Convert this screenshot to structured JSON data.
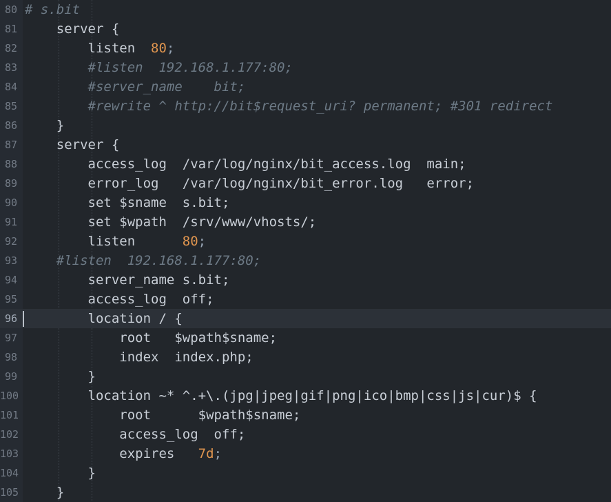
{
  "editor": {
    "app": "code-editor",
    "language": "nginx-conf",
    "first_line_number": 80,
    "current_line_number": 96,
    "colors": {
      "background": "#22262b",
      "gutter_background": "#262b32",
      "current_line_background": "#2c3138",
      "text": "#c8ced6",
      "line_number": "#737b86",
      "line_number_active": "#a3acb8",
      "comment": "#6d7a86",
      "number": "#e0954f",
      "punctuation": "#96a3b3",
      "caret": "#b9c0c8",
      "indent_guide": "#3d434b"
    },
    "lines": [
      {
        "n": "80",
        "current": false,
        "tokens": [
          {
            "t": "comment",
            "s": "# s.bit"
          }
        ]
      },
      {
        "n": "81",
        "current": false,
        "tokens": [
          {
            "t": "plain",
            "s": "    server {"
          }
        ]
      },
      {
        "n": "82",
        "current": false,
        "tokens": [
          {
            "t": "plain",
            "s": "        listen  "
          },
          {
            "t": "num",
            "s": "80"
          },
          {
            "t": "punc",
            "s": ";"
          }
        ]
      },
      {
        "n": "83",
        "current": false,
        "tokens": [
          {
            "t": "comment",
            "s": "        #listen  192.168.1.177:80;"
          }
        ]
      },
      {
        "n": "84",
        "current": false,
        "tokens": [
          {
            "t": "comment",
            "s": "        #server_name    bit;"
          }
        ]
      },
      {
        "n": "85",
        "current": false,
        "tokens": [
          {
            "t": "comment",
            "s": "        #rewrite ^ http://bit$request_uri? permanent; #301 redirect"
          }
        ]
      },
      {
        "n": "86",
        "current": false,
        "tokens": [
          {
            "t": "plain",
            "s": "    }"
          }
        ]
      },
      {
        "n": "87",
        "current": false,
        "tokens": [
          {
            "t": "plain",
            "s": "    server {"
          }
        ]
      },
      {
        "n": "88",
        "current": false,
        "tokens": [
          {
            "t": "plain",
            "s": "        access_log  /var/log/nginx/bit_access.log  main;"
          }
        ]
      },
      {
        "n": "89",
        "current": false,
        "tokens": [
          {
            "t": "plain",
            "s": "        error_log   /var/log/nginx/bit_error.log   error;"
          }
        ]
      },
      {
        "n": "90",
        "current": false,
        "tokens": [
          {
            "t": "plain",
            "s": "        set $sname  s.bit;"
          }
        ]
      },
      {
        "n": "91",
        "current": false,
        "tokens": [
          {
            "t": "plain",
            "s": "        set $wpath  /srv/www/vhosts/;"
          }
        ]
      },
      {
        "n": "92",
        "current": false,
        "tokens": [
          {
            "t": "plain",
            "s": "        listen      "
          },
          {
            "t": "num",
            "s": "80"
          },
          {
            "t": "punc",
            "s": ";"
          }
        ]
      },
      {
        "n": "93",
        "current": false,
        "tokens": [
          {
            "t": "comment",
            "s": "    #listen  192.168.1.177:80;"
          }
        ]
      },
      {
        "n": "94",
        "current": false,
        "tokens": [
          {
            "t": "plain",
            "s": "        server_name s.bit;"
          }
        ]
      },
      {
        "n": "95",
        "current": false,
        "tokens": [
          {
            "t": "plain",
            "s": "        access_log  off;"
          }
        ]
      },
      {
        "n": "96",
        "current": true,
        "tokens": [
          {
            "t": "plain",
            "s": "        location / {"
          }
        ]
      },
      {
        "n": "97",
        "current": false,
        "tokens": [
          {
            "t": "plain",
            "s": "            root   $wpath$sname;"
          }
        ]
      },
      {
        "n": "98",
        "current": false,
        "tokens": [
          {
            "t": "plain",
            "s": "            index  index.php;"
          }
        ]
      },
      {
        "n": "99",
        "current": false,
        "tokens": [
          {
            "t": "plain",
            "s": "        }"
          }
        ]
      },
      {
        "n": "100",
        "current": false,
        "tokens": [
          {
            "t": "plain",
            "s": "        location ~* ^.+\\.(jpg|jpeg|gif|png|ico|bmp|css|js|cur)$ {"
          }
        ]
      },
      {
        "n": "101",
        "current": false,
        "tokens": [
          {
            "t": "plain",
            "s": "            root      $wpath$sname;"
          }
        ]
      },
      {
        "n": "102",
        "current": false,
        "tokens": [
          {
            "t": "plain",
            "s": "            access_log  off;"
          }
        ]
      },
      {
        "n": "103",
        "current": false,
        "tokens": [
          {
            "t": "plain",
            "s": "            expires   "
          },
          {
            "t": "num",
            "s": "7d"
          },
          {
            "t": "punc",
            "s": ";"
          }
        ]
      },
      {
        "n": "104",
        "current": false,
        "tokens": [
          {
            "t": "plain",
            "s": "        }"
          }
        ]
      },
      {
        "n": "105",
        "current": false,
        "tokens": [
          {
            "t": "plain",
            "s": "    }"
          }
        ]
      }
    ]
  }
}
